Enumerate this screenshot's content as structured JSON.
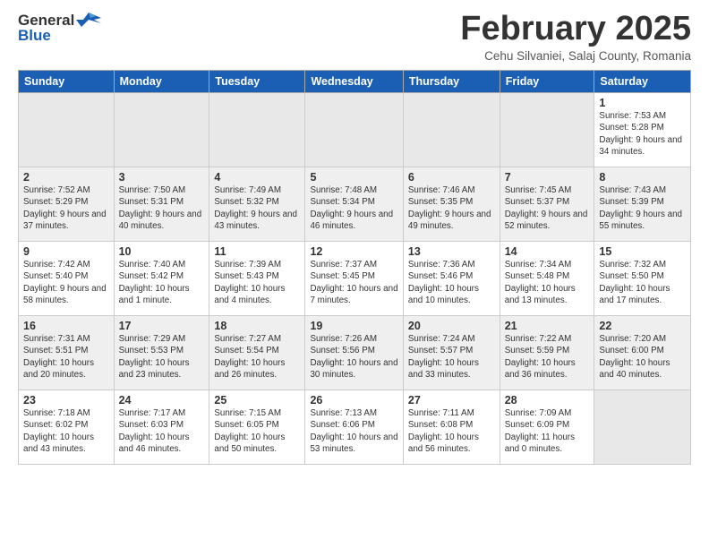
{
  "header": {
    "logo_line1": "General",
    "logo_line2": "Blue",
    "title": "February 2025",
    "location": "Cehu Silvaniei, Salaj County, Romania"
  },
  "weekdays": [
    "Sunday",
    "Monday",
    "Tuesday",
    "Wednesday",
    "Thursday",
    "Friday",
    "Saturday"
  ],
  "weeks": [
    [
      {
        "day": "",
        "text": ""
      },
      {
        "day": "",
        "text": ""
      },
      {
        "day": "",
        "text": ""
      },
      {
        "day": "",
        "text": ""
      },
      {
        "day": "",
        "text": ""
      },
      {
        "day": "",
        "text": ""
      },
      {
        "day": "1",
        "text": "Sunrise: 7:53 AM\nSunset: 5:28 PM\nDaylight: 9 hours and 34 minutes."
      }
    ],
    [
      {
        "day": "2",
        "text": "Sunrise: 7:52 AM\nSunset: 5:29 PM\nDaylight: 9 hours and 37 minutes."
      },
      {
        "day": "3",
        "text": "Sunrise: 7:50 AM\nSunset: 5:31 PM\nDaylight: 9 hours and 40 minutes."
      },
      {
        "day": "4",
        "text": "Sunrise: 7:49 AM\nSunset: 5:32 PM\nDaylight: 9 hours and 43 minutes."
      },
      {
        "day": "5",
        "text": "Sunrise: 7:48 AM\nSunset: 5:34 PM\nDaylight: 9 hours and 46 minutes."
      },
      {
        "day": "6",
        "text": "Sunrise: 7:46 AM\nSunset: 5:35 PM\nDaylight: 9 hours and 49 minutes."
      },
      {
        "day": "7",
        "text": "Sunrise: 7:45 AM\nSunset: 5:37 PM\nDaylight: 9 hours and 52 minutes."
      },
      {
        "day": "8",
        "text": "Sunrise: 7:43 AM\nSunset: 5:39 PM\nDaylight: 9 hours and 55 minutes."
      }
    ],
    [
      {
        "day": "9",
        "text": "Sunrise: 7:42 AM\nSunset: 5:40 PM\nDaylight: 9 hours and 58 minutes."
      },
      {
        "day": "10",
        "text": "Sunrise: 7:40 AM\nSunset: 5:42 PM\nDaylight: 10 hours and 1 minute."
      },
      {
        "day": "11",
        "text": "Sunrise: 7:39 AM\nSunset: 5:43 PM\nDaylight: 10 hours and 4 minutes."
      },
      {
        "day": "12",
        "text": "Sunrise: 7:37 AM\nSunset: 5:45 PM\nDaylight: 10 hours and 7 minutes."
      },
      {
        "day": "13",
        "text": "Sunrise: 7:36 AM\nSunset: 5:46 PM\nDaylight: 10 hours and 10 minutes."
      },
      {
        "day": "14",
        "text": "Sunrise: 7:34 AM\nSunset: 5:48 PM\nDaylight: 10 hours and 13 minutes."
      },
      {
        "day": "15",
        "text": "Sunrise: 7:32 AM\nSunset: 5:50 PM\nDaylight: 10 hours and 17 minutes."
      }
    ],
    [
      {
        "day": "16",
        "text": "Sunrise: 7:31 AM\nSunset: 5:51 PM\nDaylight: 10 hours and 20 minutes."
      },
      {
        "day": "17",
        "text": "Sunrise: 7:29 AM\nSunset: 5:53 PM\nDaylight: 10 hours and 23 minutes."
      },
      {
        "day": "18",
        "text": "Sunrise: 7:27 AM\nSunset: 5:54 PM\nDaylight: 10 hours and 26 minutes."
      },
      {
        "day": "19",
        "text": "Sunrise: 7:26 AM\nSunset: 5:56 PM\nDaylight: 10 hours and 30 minutes."
      },
      {
        "day": "20",
        "text": "Sunrise: 7:24 AM\nSunset: 5:57 PM\nDaylight: 10 hours and 33 minutes."
      },
      {
        "day": "21",
        "text": "Sunrise: 7:22 AM\nSunset: 5:59 PM\nDaylight: 10 hours and 36 minutes."
      },
      {
        "day": "22",
        "text": "Sunrise: 7:20 AM\nSunset: 6:00 PM\nDaylight: 10 hours and 40 minutes."
      }
    ],
    [
      {
        "day": "23",
        "text": "Sunrise: 7:18 AM\nSunset: 6:02 PM\nDaylight: 10 hours and 43 minutes."
      },
      {
        "day": "24",
        "text": "Sunrise: 7:17 AM\nSunset: 6:03 PM\nDaylight: 10 hours and 46 minutes."
      },
      {
        "day": "25",
        "text": "Sunrise: 7:15 AM\nSunset: 6:05 PM\nDaylight: 10 hours and 50 minutes."
      },
      {
        "day": "26",
        "text": "Sunrise: 7:13 AM\nSunset: 6:06 PM\nDaylight: 10 hours and 53 minutes."
      },
      {
        "day": "27",
        "text": "Sunrise: 7:11 AM\nSunset: 6:08 PM\nDaylight: 10 hours and 56 minutes."
      },
      {
        "day": "28",
        "text": "Sunrise: 7:09 AM\nSunset: 6:09 PM\nDaylight: 11 hours and 0 minutes."
      },
      {
        "day": "",
        "text": ""
      }
    ]
  ]
}
